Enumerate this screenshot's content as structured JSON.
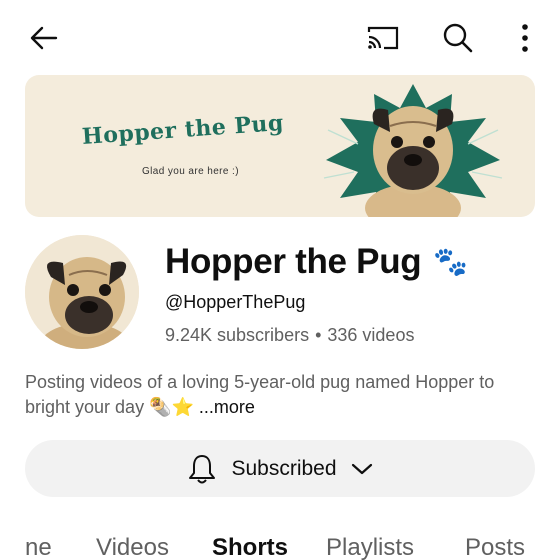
{
  "header": {
    "back_icon": "arrow-left-icon",
    "cast_icon": "cast-icon",
    "search_icon": "search-icon",
    "more_icon": "more-vert-icon"
  },
  "banner": {
    "title": "Hopper the Pug",
    "subtitle": "Glad you are here :)"
  },
  "channel": {
    "name": "Hopper the Pug",
    "name_emoji": "🐾",
    "handle": "@HopperThePug",
    "subscribers": "9.24K subscribers",
    "separator": "•",
    "videos": "336 videos",
    "description": "Posting videos of a loving 5-year-old pug named Hopper to bright your day 🌯⭐",
    "more_label": "...more"
  },
  "subscribe": {
    "label": "Subscribed",
    "bell_icon": "bell-icon",
    "chevron_icon": "chevron-down-icon"
  },
  "tabs": [
    {
      "label": "ne"
    },
    {
      "label": "Videos"
    },
    {
      "label": "Shorts"
    },
    {
      "label": "Playlists"
    },
    {
      "label": "Posts"
    }
  ],
  "colors": {
    "banner_bg": "#f4ecdc",
    "banner_accent": "#1f6f5d",
    "paw": "#1e5ec8",
    "button_bg": "#f2f2f2"
  }
}
